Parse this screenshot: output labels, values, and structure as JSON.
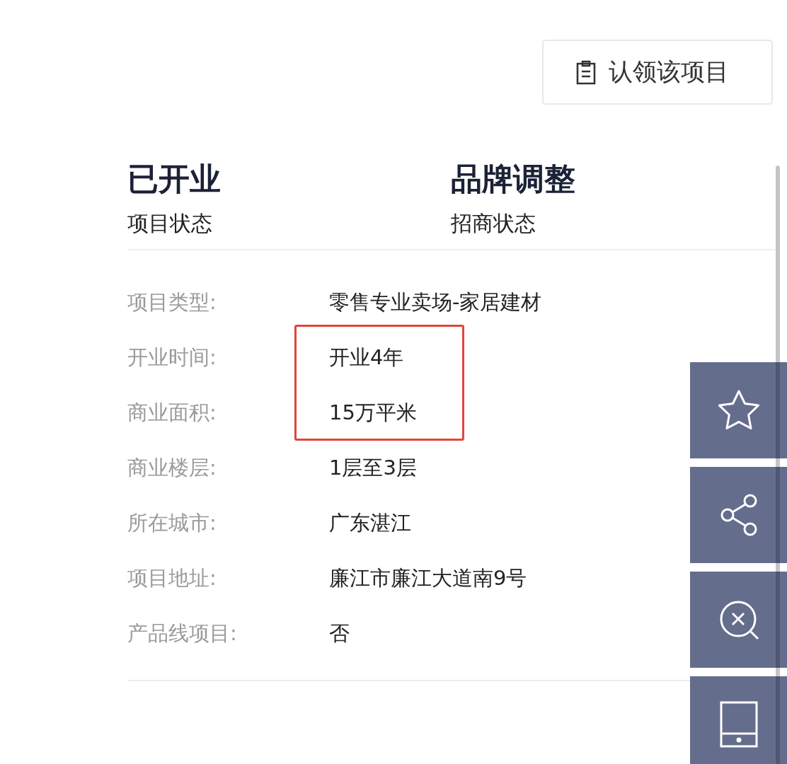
{
  "claim_button": {
    "label": "认领该项目"
  },
  "stats": [
    {
      "value": "已开业",
      "label": "项目状态"
    },
    {
      "value": "品牌调整",
      "label": "招商状态"
    }
  ],
  "details": [
    {
      "label": "项目类型:",
      "value": "零售专业卖场-家居建材",
      "highlighted": false
    },
    {
      "label": "开业时间:",
      "value": "开业4年",
      "highlighted": true
    },
    {
      "label": "商业面积:",
      "value": "15万平米",
      "highlighted": true
    },
    {
      "label": "商业楼层:",
      "value": "1层至3层",
      "highlighted": false
    },
    {
      "label": "所在城市:",
      "value": "广东湛江",
      "highlighted": false
    },
    {
      "label": "项目地址:",
      "value": "廉江市廉江大道南9号",
      "highlighted": false
    },
    {
      "label": "产品线项目:",
      "value": "否",
      "highlighted": false
    }
  ]
}
